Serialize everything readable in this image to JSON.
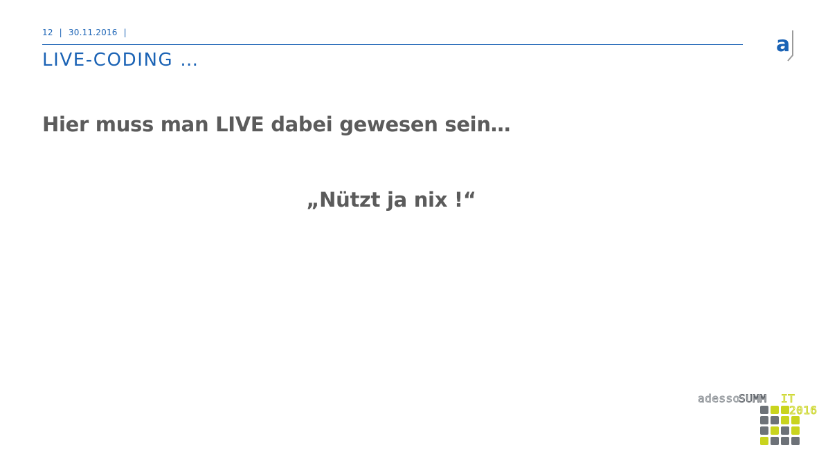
{
  "header": {
    "page_number": "12",
    "date": "30.11.2016",
    "separator": "|"
  },
  "title": "LIVE-CODING …",
  "body": {
    "heading": "Hier muss man LIVE dabei gewesen sein…",
    "quote": "„Nützt ja nix !“"
  },
  "logo": {
    "letter": "a",
    "icon": "adesso-logo-icon"
  },
  "event_logo": {
    "brand": "adesso",
    "event_prefix": "SUMM",
    "event_suffix": "IT",
    "year": "2016",
    "icon": "adesso-summit-2016-logo-icon"
  },
  "colors": {
    "accent": "#1b63b5",
    "text": "#5b5b5b",
    "logo_grey": "#6d7278",
    "logo_yellow": "#c9d41e"
  }
}
